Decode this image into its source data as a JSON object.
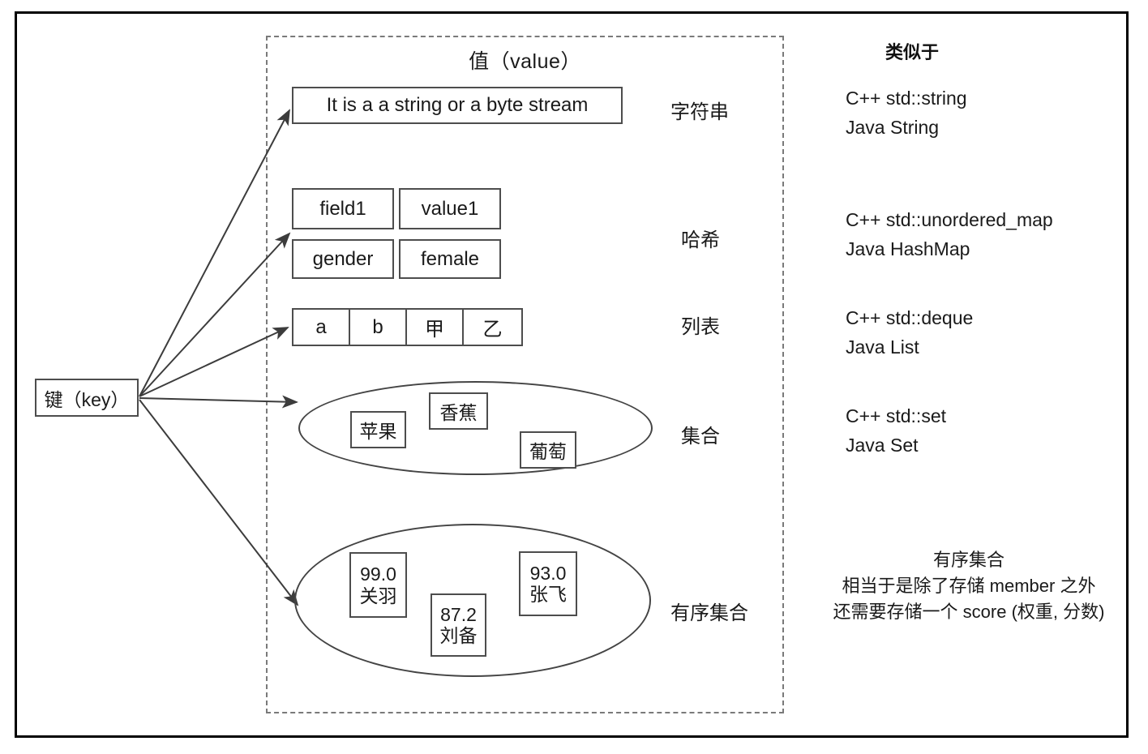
{
  "diagram": {
    "key_box": {
      "label": "键（key）"
    },
    "value_region": {
      "title": "值（value）"
    },
    "similar_column_title": "类似于",
    "rows": [
      {
        "type_label": "字符串",
        "analogs": [
          "C++ std::string",
          "Java String"
        ],
        "string_value": "It is a a string or a byte stream"
      },
      {
        "type_label": "哈希",
        "analogs": [
          "C++ std::unordered_map",
          "Java HashMap"
        ],
        "hash_pairs": [
          {
            "field": "field1",
            "value": "value1"
          },
          {
            "field": "gender",
            "value": "female"
          }
        ]
      },
      {
        "type_label": "列表",
        "analogs": [
          "C++ std::deque",
          "Java List"
        ],
        "list_items": [
          "a",
          "b",
          "甲",
          "乙"
        ]
      },
      {
        "type_label": "集合",
        "analogs": [
          "C++ std::set",
          "Java Set"
        ],
        "set_items": [
          "苹果",
          "香蕉",
          "葡萄"
        ]
      },
      {
        "type_label": "有序集合",
        "analogs": [],
        "zset_items": [
          {
            "score": "99.0",
            "member": "关羽"
          },
          {
            "score": "87.2",
            "member": "刘备"
          },
          {
            "score": "93.0",
            "member": "张飞"
          }
        ],
        "note": {
          "heading": "有序集合",
          "line1": "相当于是除了存储 member 之外",
          "line2": "还需要存储一个 score (权重, 分数)"
        }
      }
    ]
  },
  "colors": {
    "frame": "#000000",
    "dashed": "#7a7a7a",
    "box_border": "#4d4d4d",
    "ellipse_border": "#444444",
    "arrow": "#3c3c3c",
    "text": "#1a1a1a",
    "background": "#ffffff"
  }
}
